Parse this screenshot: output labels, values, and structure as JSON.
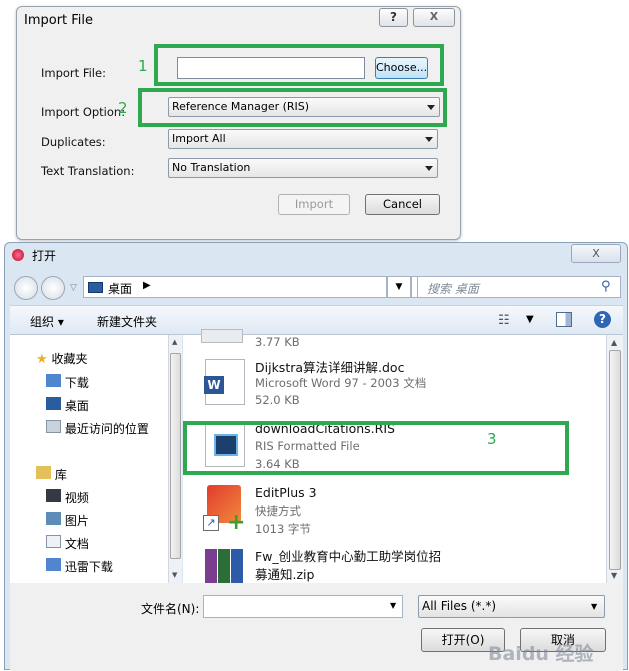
{
  "import_dialog": {
    "title": "Import File",
    "help_button": "?",
    "close_button": "X",
    "import_file_label": "Import File:",
    "import_file_value": "",
    "choose_button": "Choose...",
    "import_option_label": "Import Option:",
    "import_option_value": "Reference Manager (RIS)",
    "duplicates_label": "Duplicates:",
    "duplicates_value": "Import All",
    "text_translation_label": "Text Translation:",
    "text_translation_value": "No Translation",
    "import_button": "Import",
    "cancel_button": "Cancel"
  },
  "annotations": {
    "n1": "1",
    "n2": "2",
    "n3": "3",
    "highlight_color": "#2fa84f"
  },
  "open_dialog": {
    "title": "打开",
    "close_button": "X",
    "address_path": "桌面",
    "search_placeholder": "搜索 桌面",
    "organize_label": "组织",
    "new_folder_label": "新建文件夹",
    "favorites_header": "收藏夹",
    "favorites": [
      "下载",
      "桌面",
      "最近访问的位置"
    ],
    "library_header": "库",
    "libraries": [
      "视频",
      "图片",
      "文档",
      "迅雷下载"
    ],
    "files": [
      {
        "name": "",
        "sub": "",
        "size": "3.77 KB"
      },
      {
        "name": "Dijkstra算法详细讲解.doc",
        "sub": "Microsoft Word 97 - 2003 文档",
        "size": "52.0 KB"
      },
      {
        "name": "downloadCitations.RIS",
        "sub": "RIS Formatted File",
        "size": "3.64 KB"
      },
      {
        "name": "EditPlus 3",
        "sub": "快捷方式",
        "size": "1013 字节"
      },
      {
        "name": "Fw_创业教育中心勤工助学岗位招",
        "name2": "募通知.zip",
        "sub": "",
        "size": ""
      }
    ],
    "filename_label": "文件名(N):",
    "filename_value": "",
    "filetype_value": "All Files (*.*)",
    "open_button": "打开(O)",
    "cancel_button": "取消",
    "watermark": "Baidu 经验"
  }
}
